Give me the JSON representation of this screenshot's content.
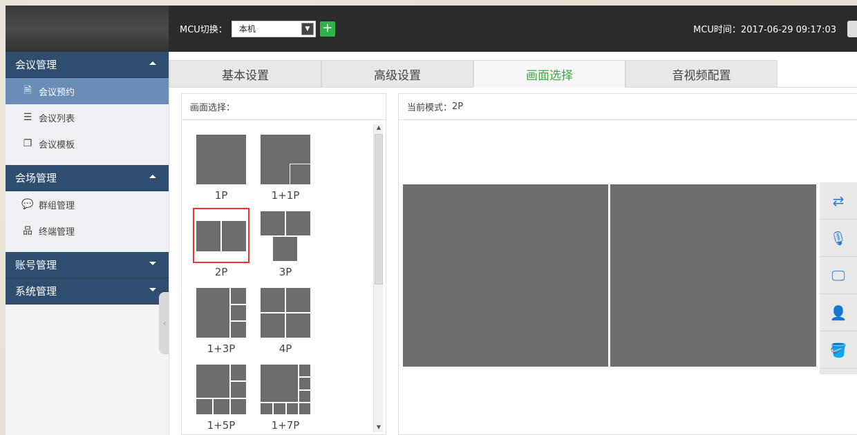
{
  "header": {
    "mcu_switch_label": "MCU切换：",
    "mcu_select_value": "本机",
    "add_icon": "plus-icon",
    "mcu_time_label": "MCU时间：",
    "mcu_time_value": "2017-06-29 09:17:03"
  },
  "sidebar": {
    "groups": [
      {
        "label": "会议管理",
        "expanded": true,
        "items": [
          {
            "label": "会议预约",
            "icon": "document-icon",
            "active": true
          },
          {
            "label": "会议列表",
            "icon": "list-icon",
            "active": false
          },
          {
            "label": "会议模板",
            "icon": "template-icon",
            "active": false
          }
        ]
      },
      {
        "label": "会场管理",
        "expanded": true,
        "items": [
          {
            "label": "群组管理",
            "icon": "chat-icon",
            "active": false
          },
          {
            "label": "终端管理",
            "icon": "hierarchy-icon",
            "active": false
          }
        ]
      },
      {
        "label": "账号管理",
        "expanded": false,
        "items": []
      },
      {
        "label": "系统管理",
        "expanded": false,
        "items": []
      }
    ]
  },
  "tabs": [
    {
      "label": "基本设置",
      "active": false
    },
    {
      "label": "高级设置",
      "active": false
    },
    {
      "label": "画面选择",
      "active": true
    },
    {
      "label": "音视频配置",
      "active": false
    }
  ],
  "layout_panel": {
    "title": "画面选择：",
    "layouts": [
      {
        "label": "1P",
        "selected": false
      },
      {
        "label": "1+1P",
        "selected": false
      },
      {
        "label": "2P",
        "selected": true
      },
      {
        "label": "3P",
        "selected": false
      },
      {
        "label": "1+3P",
        "selected": false
      },
      {
        "label": "4P",
        "selected": false
      },
      {
        "label": "1+5P",
        "selected": false
      },
      {
        "label": "1+7P",
        "selected": false
      }
    ]
  },
  "preview_panel": {
    "mode_label": "当前模式：",
    "mode_value": "2P"
  },
  "tools": [
    {
      "icon": "swap-icon"
    },
    {
      "icon": "microphone-icon"
    },
    {
      "icon": "monitor-icon"
    },
    {
      "icon": "user-icon"
    },
    {
      "icon": "paint-bucket-icon"
    }
  ],
  "colors": {
    "sidebar_group_bg": "#2f4d6e",
    "sidebar_active_bg": "#6a8db8",
    "active_tab_text": "#3aa843",
    "selected_border": "#e33333",
    "tile_gray": "#6d6d6d",
    "tool_icon": "#2c7fd0"
  }
}
